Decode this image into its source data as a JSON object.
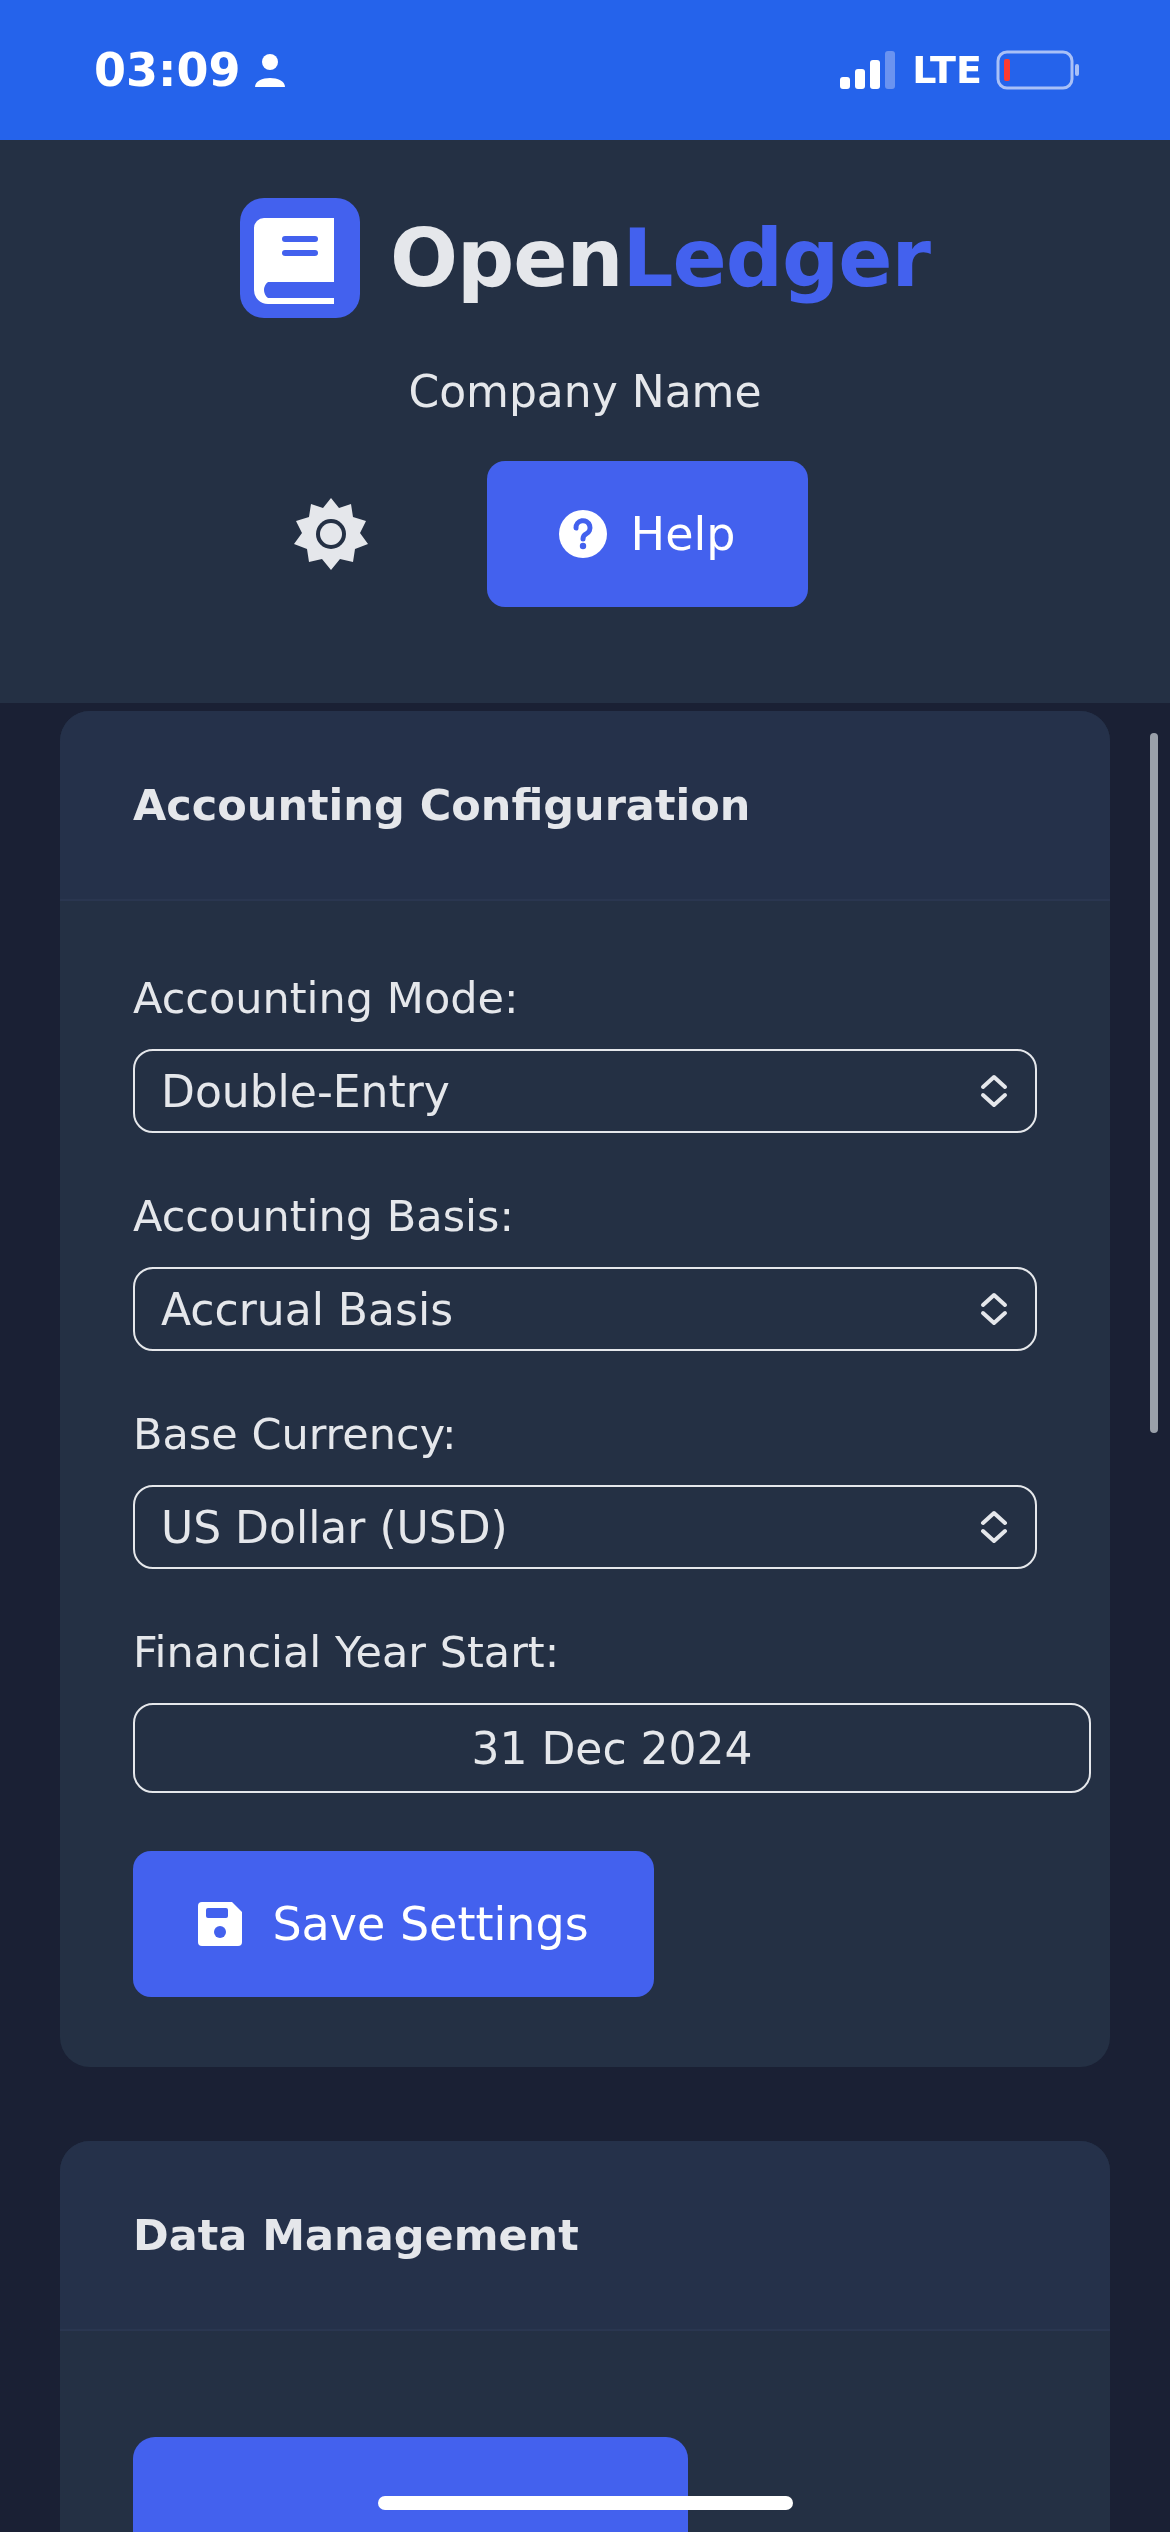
{
  "status_bar": {
    "time": "03:09",
    "network": "LTE"
  },
  "header": {
    "logo": {
      "first": "Open",
      "second": "Ledger"
    },
    "company": "Company Name",
    "help_button": "Help"
  },
  "cards": [
    {
      "title": "Accounting Configuration",
      "fields": [
        {
          "kind": "select",
          "label": "Accounting Mode:",
          "value": "Double-Entry"
        },
        {
          "kind": "select",
          "label": "Accounting Basis:",
          "value": "Accrual Basis"
        },
        {
          "kind": "select",
          "label": "Base Currency:",
          "value": "US Dollar (USD)"
        },
        {
          "kind": "date",
          "label": "Financial Year Start:",
          "value": "31 Dec 2024"
        }
      ],
      "button": "Save Settings"
    },
    {
      "title": "Data Management"
    }
  ]
}
